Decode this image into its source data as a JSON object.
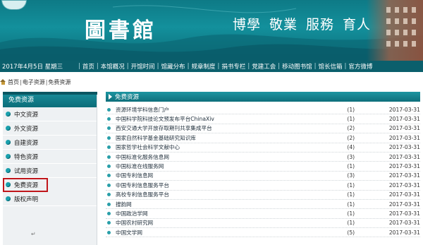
{
  "banner": {
    "library_title": "圖書館",
    "motto": [
      "博學",
      "敬業",
      "服務",
      "育人"
    ]
  },
  "navbar": {
    "date": "2017年4月5日 星期三",
    "links": [
      "首页",
      "本馆概况",
      "开馆时间",
      "馆藏分布",
      "规章制度",
      "捐书专栏",
      "党建工会",
      "移动图书馆",
      "馆长信箱",
      "官方微博"
    ]
  },
  "breadcrumb": {
    "items": [
      "首页",
      "电子资源",
      "免费资源"
    ]
  },
  "sidebar": {
    "header": "免费资源",
    "items": [
      "中文资源",
      "外文资源",
      "自建资源",
      "特色资源",
      "试用资源",
      "免费资源",
      "版权声明"
    ],
    "highlighted": "免费资源",
    "highlight_color": "#c0161b"
  },
  "main": {
    "header": "免费资源",
    "rows": [
      {
        "title": "资源环境学科信息门户",
        "count": "(1)",
        "date": "2017-03-31"
      },
      {
        "title": "中国科学院科技论文预发布平台ChinaXiv",
        "count": "(1)",
        "date": "2017-03-31"
      },
      {
        "title": "西安交通大学开放存取期刊共享集成平台",
        "count": "(2)",
        "date": "2017-03-31"
      },
      {
        "title": "国家自然科学基金基础研究知识库",
        "count": "(2)",
        "date": "2017-03-31"
      },
      {
        "title": "国家哲学社会科学文献中心",
        "count": "(4)",
        "date": "2017-03-31"
      },
      {
        "title": "中国标准化服务信息网",
        "count": "(3)",
        "date": "2017-03-31"
      },
      {
        "title": "中国标准在线服务网",
        "count": "(1)",
        "date": "2017-03-31"
      },
      {
        "title": "中国专利信息网",
        "count": "(3)",
        "date": "2017-03-31"
      },
      {
        "title": "中国专利信息服务平台",
        "count": "(1)",
        "date": "2017-03-31"
      },
      {
        "title": "高校专利信息服务平台",
        "count": "(1)",
        "date": "2017-03-31"
      },
      {
        "title": "搜韵网",
        "count": "(1)",
        "date": "2017-03-31"
      },
      {
        "title": "中国政治学网",
        "count": "(1)",
        "date": "2017-03-31"
      },
      {
        "title": "中国农村研究网",
        "count": "(1)",
        "date": "2017-03-31"
      },
      {
        "title": "中国文学网",
        "count": "(5)",
        "date": "2017-03-31"
      }
    ]
  },
  "colors": {
    "accent": "#0e7a86",
    "nav_bg": "#0b5f6c"
  }
}
